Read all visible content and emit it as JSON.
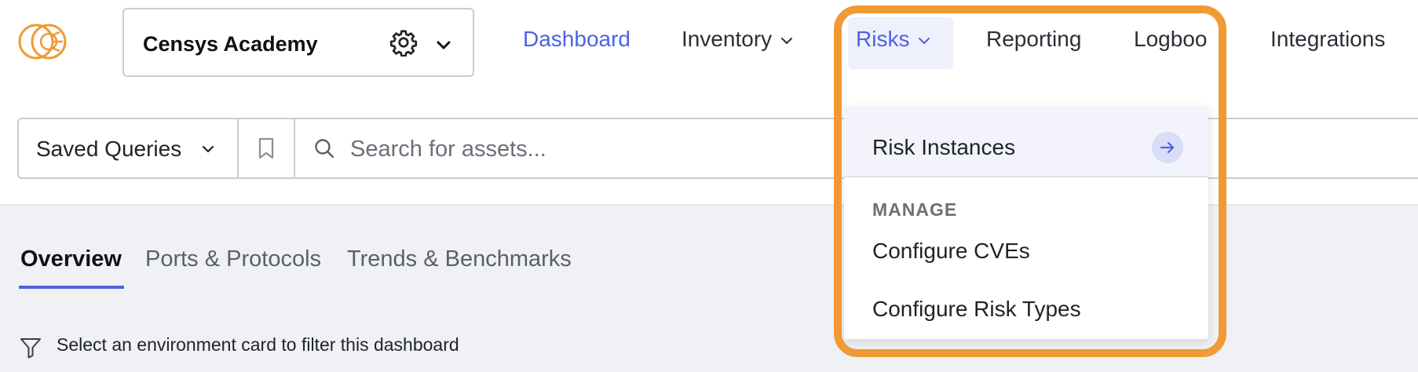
{
  "workspace": {
    "name": "Censys Academy"
  },
  "nav": {
    "items": [
      {
        "label": "Dashboard"
      },
      {
        "label": "Inventory"
      },
      {
        "label": "Risks"
      },
      {
        "label": "Reporting"
      },
      {
        "label": "Logboo"
      },
      {
        "label": "Integrations"
      }
    ]
  },
  "search": {
    "saved_queries_label": "Saved Queries",
    "placeholder": "Search for assets..."
  },
  "tabs": [
    {
      "label": "Overview"
    },
    {
      "label": "Ports & Protocols"
    },
    {
      "label": "Trends & Benchmarks"
    }
  ],
  "filter_hint": "Select an environment card to filter this dashboard",
  "risks_menu": {
    "primary_item": "Risk Instances",
    "section_heading": "MANAGE",
    "items": [
      {
        "label": "Configure CVEs"
      },
      {
        "label": "Configure Risk Types"
      }
    ]
  },
  "colors": {
    "accent": "#4b63e6",
    "brand_orange": "#f09a35",
    "highlight_border": "#f09a35"
  },
  "icons": [
    "logo-icon",
    "gear-icon",
    "chevron-down-icon",
    "bookmark-icon",
    "search-icon",
    "arrow-right-icon",
    "filter-icon"
  ]
}
